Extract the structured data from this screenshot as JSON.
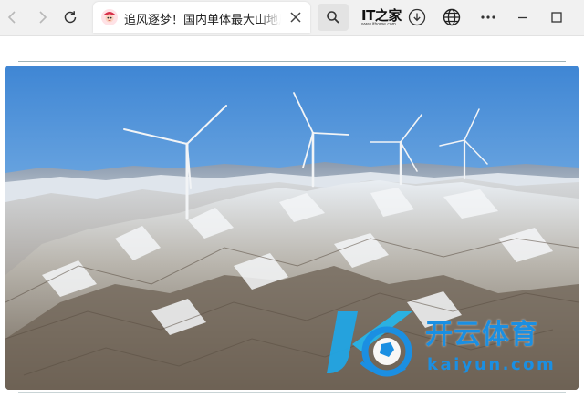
{
  "browser": {
    "tab_title": "追风逐梦！国内单体最大山地风电",
    "logo_main": "IT之家",
    "logo_sub": "www.ithome.com"
  },
  "icons": {
    "back": "back-arrow-icon",
    "forward": "forward-arrow-icon",
    "reload": "reload-icon",
    "favicon": "site-favicon-icon",
    "close": "close-icon",
    "search": "search-icon",
    "download": "download-icon",
    "globe": "globe-icon",
    "more": "more-horizontal-icon",
    "minimize": "minimize-icon",
    "maximize": "maximize-icon"
  },
  "article": {
    "image_subject": "wind-turbines-on-snowy-mountain"
  },
  "watermark": {
    "cn": "开云体育",
    "en": "kaiyun.com"
  },
  "colors": {
    "accent": "#1b8fe2",
    "tab_bg": "#ffffff",
    "toolbar_bg": "#f1f1f1"
  }
}
